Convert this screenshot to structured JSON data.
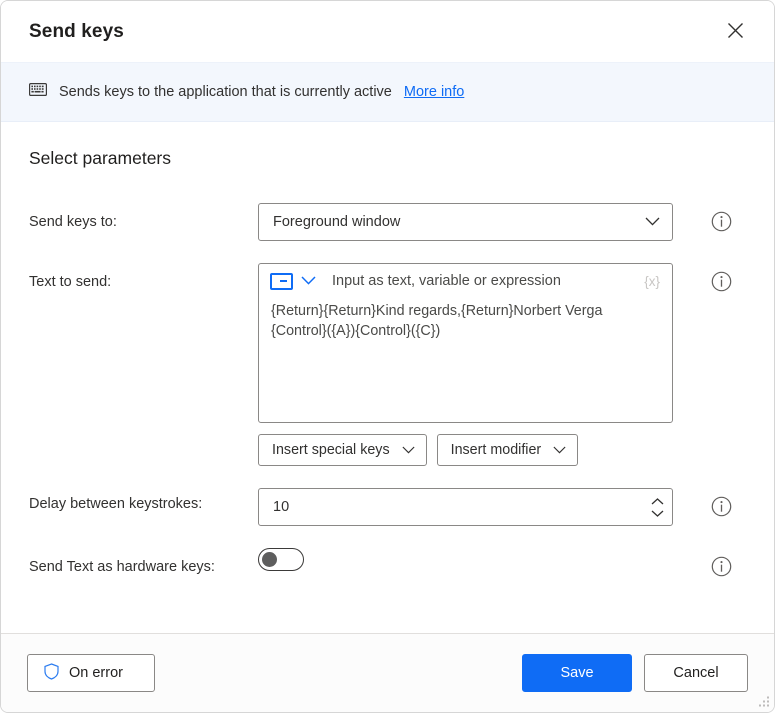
{
  "window": {
    "title": "Send keys",
    "close_label": "×",
    "close_icon": "close-icon",
    "resize_grip_icon": "resize-grip-icon"
  },
  "banner": {
    "icon": "keyboard-icon",
    "text": "Sends keys to the application that is currently active",
    "link_label": "More info"
  },
  "section": {
    "heading": "Select parameters"
  },
  "fields": {
    "send_keys_to": {
      "label": "Send keys to:",
      "value": "Foreground window",
      "options": [
        "Foreground window"
      ],
      "chevron_icon": "chevron-down-icon",
      "info_icon": "info-icon"
    },
    "text_to_send": {
      "label": "Text to send:",
      "type_icon": "input-type-icon",
      "type_chevron_icon": "chevron-down-icon",
      "placeholder": "Input as text, variable or expression",
      "variable_badge": "{x}",
      "value": "{Return}{Return}Kind regards,{Return}Norbert Verga\n{Control}({A}){Control}({C})",
      "info_icon": "info-icon",
      "insert_special_keys_label": "Insert special keys",
      "insert_modifier_label": "Insert modifier"
    },
    "delay": {
      "label": "Delay between keystrokes:",
      "value": "10",
      "increment_icon": "chevron-up-icon",
      "decrement_icon": "chevron-down-icon",
      "info_icon": "info-icon"
    },
    "hardware_keys": {
      "label": "Send Text as hardware keys:",
      "state": "off",
      "info_icon": "info-icon"
    }
  },
  "footer": {
    "on_error_label": "On error",
    "on_error_icon": "shield-icon",
    "save_label": "Save",
    "cancel_label": "Cancel"
  },
  "colors": {
    "accent": "#0f6cf5",
    "banner_bg": "#f3f7fd",
    "text": "#323130",
    "border": "#8a8886"
  }
}
